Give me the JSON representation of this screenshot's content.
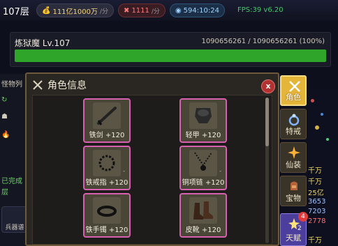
{
  "topbar": {
    "floor": "107层",
    "gold": "111亿1000万",
    "gold_unit": "/分",
    "attack": "1111",
    "attack_unit": "/分",
    "time": "594:10:24",
    "fps": "FPS:39 v6.20"
  },
  "boss": {
    "name": "炼狱魔 Lv.107",
    "hp_text": "1090656261 / 1090656261 (100%)",
    "hp_fraction": 1.0
  },
  "left_panel": {
    "tab1": "怪物列",
    "item1": "已完成",
    "item2": "层",
    "button": "兵器谱"
  },
  "right_panel": {
    "v1": "千万",
    "v2": "千万",
    "v3": "25亿",
    "v4": "3653",
    "v5": "7203",
    "v6": "2778",
    "v7": "千万"
  },
  "dialog": {
    "title": "角色信息",
    "close": "x"
  },
  "equipment": [
    {
      "label": "铁剑 +120",
      "icon": "sword-icon"
    },
    {
      "label": "轻甲 +120",
      "icon": "armor-icon"
    },
    {
      "label": "铁戒指 +120",
      "icon": "ring-icon"
    },
    {
      "label": "铜项链 +120",
      "icon": "necklace-icon"
    },
    {
      "label": "铁手镯 +120",
      "icon": "bracelet-icon"
    },
    {
      "label": "皮靴 +120",
      "icon": "boots-icon"
    }
  ],
  "tabs": [
    {
      "label": "角色",
      "icon": "crossed-swords-icon"
    },
    {
      "label": "特戒",
      "icon": "special-ring-icon"
    },
    {
      "label": "仙装",
      "icon": "spark-icon"
    },
    {
      "label": "宝物",
      "icon": "treasure-icon"
    },
    {
      "label": "天赋",
      "icon": "talent-icon",
      "badge": "4",
      "badge2": "2"
    }
  ],
  "colors": {
    "slot_border": "#d860b0",
    "hp_fill": "#2fa52a",
    "active_tab": "#e5b53a"
  }
}
